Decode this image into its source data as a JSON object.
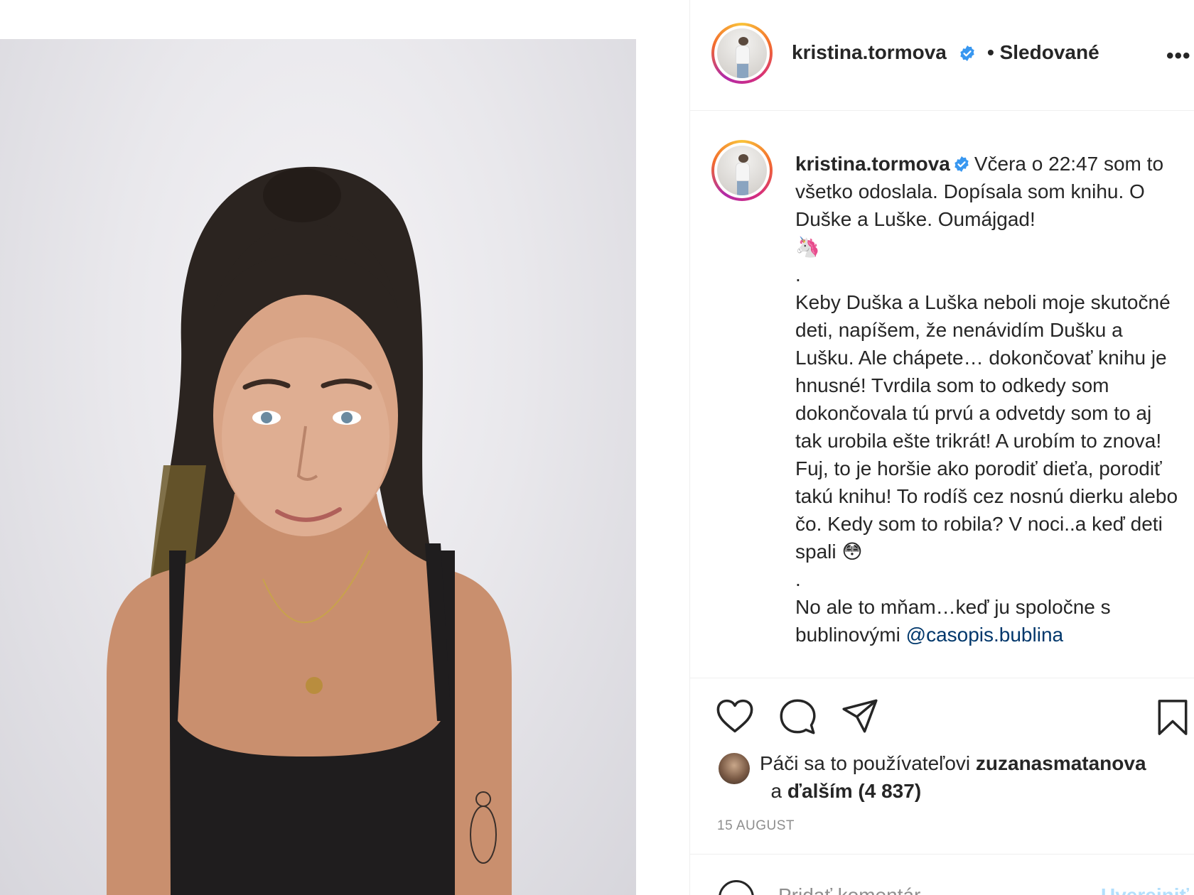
{
  "post": {
    "username": "kristina.tormova",
    "follow_status": "• Sledované",
    "more_label": "•••",
    "caption": {
      "username": "kristina.tormova",
      "line1": "Včera o 22:47 som to všetko odoslala. Dopísala som knihu. O Duške a Luške. Oumájgad!",
      "emoji1": "🦄",
      "dot1": ".",
      "paragraph2": "Keby Duška a Luška neboli moje skutočné deti, napíšem, že nenávidím Dušku a Lušku. Ale chápete… dokončovať knihu je hnusné! Tvrdila som to odkedy som dokončovala tú prvú a odvetdy som to aj tak urobila ešte trikrát! A urobím to znova! Fuj, to je horšie ako porodiť dieťa, porodiť takú knihu! To rodíš cez nosnú dierku alebo čo. Kedy som to robila? V noci..a keď deti spali",
      "emoji2": "😳",
      "dot2": ".",
      "paragraph3_start": "No ale to mňam…keď ju spoločne s bublinovými ",
      "mention": "@casopis.bublina"
    },
    "likes": {
      "prefix": "Páči sa to používateľovi ",
      "user": "zuzanasmatanova",
      "and": " a ",
      "others": "ďalším (4 837)"
    },
    "date": "15 AUGUST",
    "comment_placeholder": "Pridať komentár...",
    "post_button": "Uverejniť"
  },
  "colors": {
    "text": "#262626",
    "secondary": "#8e8e8e",
    "verified": "#3897f0",
    "mention": "#00376b",
    "divider": "#efefef"
  },
  "icons": [
    "heart-icon",
    "comment-icon",
    "share-icon",
    "bookmark-icon",
    "verified-badge-icon",
    "more-options-icon",
    "emoji-icon"
  ]
}
